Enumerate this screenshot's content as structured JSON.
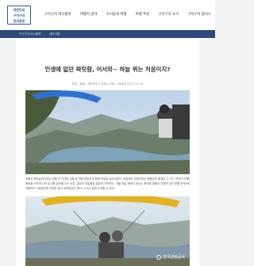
{
  "header": {
    "logo_lines": [
      "대한민국",
      "구석구석",
      "한국관광"
    ],
    "nav": [
      "구석구석 떠나볼까",
      "여행지 검색",
      "우리동네 여행",
      "여행 추천",
      "구석구석 소식",
      "구석구석 플러스"
    ]
  },
  "breadcrumb": [
    "구석구석 떠나볼까",
    "테마여행"
  ],
  "article": {
    "title": "인생에 없던 짜릿함, 어서와~ 하늘 위는 처음이지?",
    "meta": "자연 · 힐링 · 액티비티  |  조회 4,482  |  작성일 2017.12.08",
    "paragraph_lines": [
      "청풍호 패러글라이딩은 비행 전 간단한 교육 후 전문 파일럿과 함께 하늘로 날아오른다. 하늘에서 내려다보는 청풍호의 풍경은 그 어느 곳보다 아름답다.",
      "바람을 가르며 산과 호수를 발아래 두는 순간, 일상의 답답함은 말끔히 사라진다. 겨울 하늘 위에서 만나는 짜릿한 경험이 인생의 잊지 못할 추억으로 남는다.",
      "처음이라 걱정된다면 걱정은 잠시 내려놓아도 좋다. 누구나 쉽게 도전할 수 있다."
    ],
    "watermark": "한국관광공사"
  }
}
